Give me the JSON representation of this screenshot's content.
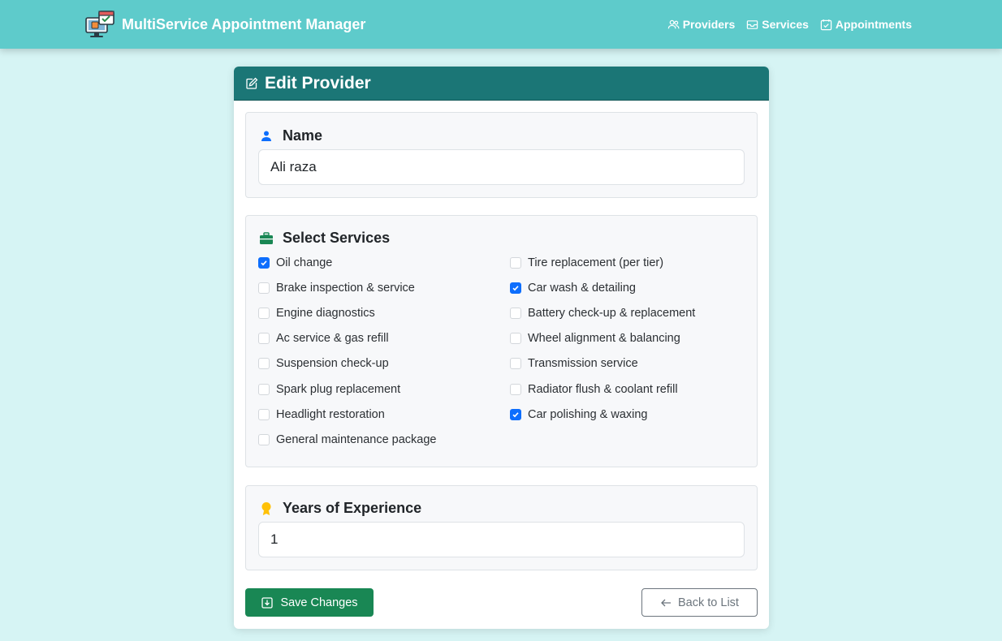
{
  "navbar": {
    "brand": "MultiService Appointment Manager",
    "links": [
      {
        "label": "Providers",
        "icon": "people-icon"
      },
      {
        "label": "Services",
        "icon": "inbox-icon"
      },
      {
        "label": "Appointments",
        "icon": "calendar-check-icon"
      }
    ]
  },
  "card": {
    "title": "Edit Provider",
    "name_section": {
      "label": "Name",
      "value": "Ali raza"
    },
    "services_section": {
      "label": "Select Services",
      "left": [
        {
          "label": "Oil change",
          "checked": true
        },
        {
          "label": "Brake inspection & service",
          "checked": false
        },
        {
          "label": "Engine diagnostics",
          "checked": false
        },
        {
          "label": "Ac service & gas refill",
          "checked": false
        },
        {
          "label": "Suspension check-up",
          "checked": false
        },
        {
          "label": "Spark plug replacement",
          "checked": false
        },
        {
          "label": "Headlight restoration",
          "checked": false
        },
        {
          "label": "General maintenance package",
          "checked": false
        }
      ],
      "right": [
        {
          "label": "Tire replacement (per tier)",
          "checked": false
        },
        {
          "label": "Car wash & detailing",
          "checked": true
        },
        {
          "label": "Battery check-up & replacement",
          "checked": false
        },
        {
          "label": "Wheel alignment & balancing",
          "checked": false
        },
        {
          "label": "Transmission service",
          "checked": false
        },
        {
          "label": "Radiator flush & coolant refill",
          "checked": false
        },
        {
          "label": "Car polishing & waxing",
          "checked": true
        }
      ]
    },
    "experience_section": {
      "label": "Years of Experience",
      "value": "1"
    },
    "save_label": "Save Changes",
    "back_label": "Back to List"
  },
  "colors": {
    "navbar": "#5ecbcb",
    "page_background": "#d6f4f4",
    "card_header": "#1b7676",
    "save_button": "#198754",
    "checkbox_checked": "#0d6efd"
  }
}
